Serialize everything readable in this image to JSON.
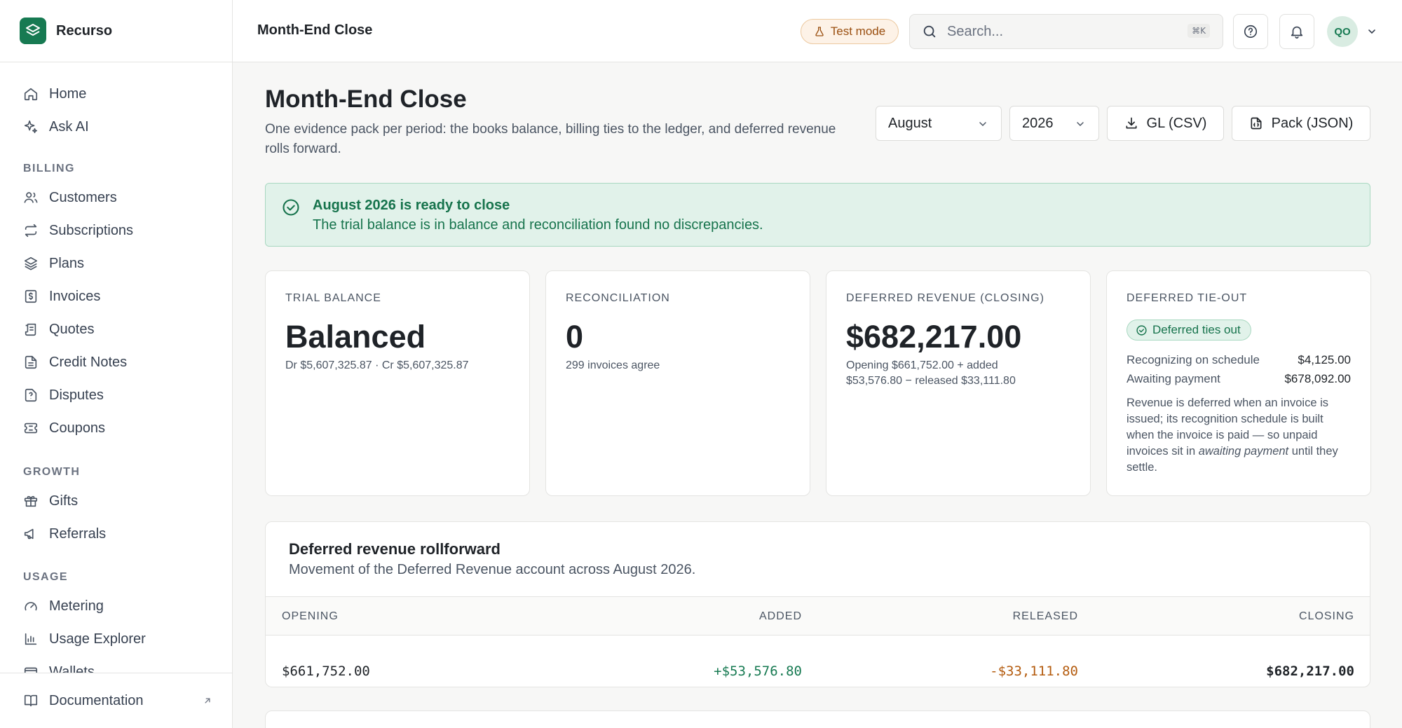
{
  "app": {
    "name": "Recurso"
  },
  "sidebar": {
    "items": [
      {
        "label": "Home",
        "icon": "home-icon"
      },
      {
        "label": "Ask AI",
        "icon": "sparkle-icon"
      }
    ],
    "groups": [
      {
        "title": "BILLING",
        "items": [
          {
            "label": "Customers",
            "icon": "users-icon"
          },
          {
            "label": "Subscriptions",
            "icon": "repeat-icon"
          },
          {
            "label": "Plans",
            "icon": "layers-icon"
          },
          {
            "label": "Invoices",
            "icon": "invoice-icon"
          },
          {
            "label": "Quotes",
            "icon": "quote-icon"
          },
          {
            "label": "Credit Notes",
            "icon": "file-icon"
          },
          {
            "label": "Disputes",
            "icon": "dispute-icon"
          },
          {
            "label": "Coupons",
            "icon": "ticket-icon"
          }
        ]
      },
      {
        "title": "GROWTH",
        "items": [
          {
            "label": "Gifts",
            "icon": "gift-icon"
          },
          {
            "label": "Referrals",
            "icon": "megaphone-icon"
          }
        ]
      },
      {
        "title": "USAGE",
        "items": [
          {
            "label": "Metering",
            "icon": "gauge-icon"
          },
          {
            "label": "Usage Explorer",
            "icon": "bar-chart-icon"
          },
          {
            "label": "Wallets",
            "icon": "wallet-icon"
          }
        ]
      }
    ],
    "footer": {
      "label": "Documentation",
      "icon": "book-icon"
    }
  },
  "topbar": {
    "title": "Month-End Close",
    "test_mode": "Test mode",
    "search_placeholder": "Search...",
    "search_shortcut": "⌘K",
    "avatar_initials": "QO"
  },
  "page": {
    "title": "Month-End Close",
    "description": "One evidence pack per period: the books balance, billing ties to the ledger, and deferred revenue rolls forward.",
    "month": "August",
    "year": "2026",
    "gl_button": "GL (CSV)",
    "pack_button": "Pack (JSON)"
  },
  "banner": {
    "title": "August 2026 is ready to close",
    "message": "The trial balance is in balance and reconciliation found no discrepancies."
  },
  "cards": {
    "trial_balance": {
      "label": "TRIAL BALANCE",
      "value": "Balanced",
      "detail": "Dr $5,607,325.87 · Cr $5,607,325.87"
    },
    "reconciliation": {
      "label": "RECONCILIATION",
      "value": "0",
      "detail": "299 invoices agree"
    },
    "deferred_revenue": {
      "label": "DEFERRED REVENUE (CLOSING)",
      "value": "$682,217.00",
      "detail": "Opening $661,752.00 + added $53,576.80 − released $33,111.80"
    },
    "tie_out": {
      "label": "DEFERRED TIE-OUT",
      "badge": "Deferred ties out",
      "rows": [
        {
          "label": "Recognizing on schedule",
          "value": "$4,125.00"
        },
        {
          "label": "Awaiting payment",
          "value": "$678,092.00"
        }
      ],
      "note_before": "Revenue is deferred when an invoice is issued; its recognition schedule is built when the invoice is paid — so unpaid invoices sit in ",
      "note_em": "awaiting payment",
      "note_after": " until they settle."
    }
  },
  "rollforward": {
    "title": "Deferred revenue rollforward",
    "description": "Movement of the Deferred Revenue account across August 2026.",
    "columns": [
      "OPENING",
      "ADDED",
      "RELEASED",
      "CLOSING"
    ],
    "row": {
      "opening": "$661,752.00",
      "added": "+$53,576.80",
      "released": "-$33,111.80",
      "closing": "$682,217.00"
    }
  },
  "colors": {
    "accent": "#177a52",
    "positive": "#177a52",
    "negative": "#b45c0f",
    "warning_bg": "#fdf2e7"
  }
}
